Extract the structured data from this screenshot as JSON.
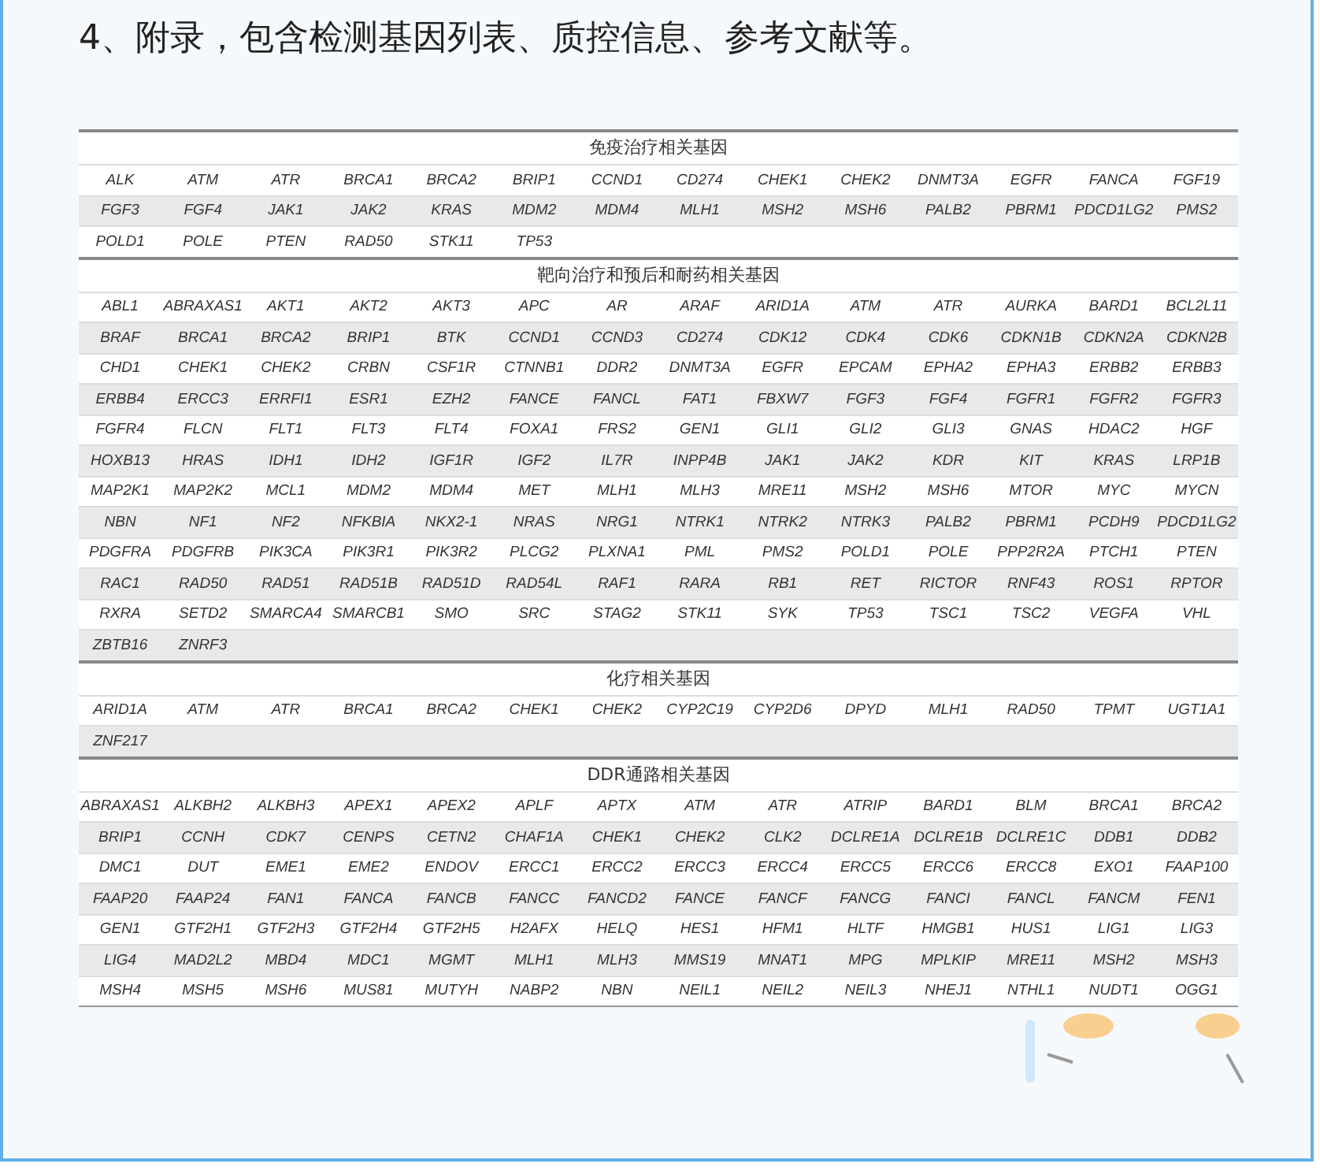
{
  "heading": "4、附录，包含检测基因列表、质控信息、参考文献等。",
  "sections": [
    {
      "title": "免疫治疗相关基因",
      "genes": [
        "ALK",
        "ATM",
        "ATR",
        "BRCA1",
        "BRCA2",
        "BRIP1",
        "CCND1",
        "CD274",
        "CHEK1",
        "CHEK2",
        "DNMT3A",
        "EGFR",
        "FANCA",
        "FGF19",
        "FGF3",
        "FGF4",
        "JAK1",
        "JAK2",
        "KRAS",
        "MDM2",
        "MDM4",
        "MLH1",
        "MSH2",
        "MSH6",
        "PALB2",
        "PBRM1",
        "PDCD1LG2",
        "PMS2",
        "POLD1",
        "POLE",
        "PTEN",
        "RAD50",
        "STK11",
        "TP53"
      ]
    },
    {
      "title": "靶向治疗和预后和耐药相关基因",
      "genes": [
        "ABL1",
        "ABRAXAS1",
        "AKT1",
        "AKT2",
        "AKT3",
        "APC",
        "AR",
        "ARAF",
        "ARID1A",
        "ATM",
        "ATR",
        "AURKA",
        "BARD1",
        "BCL2L11",
        "BRAF",
        "BRCA1",
        "BRCA2",
        "BRIP1",
        "BTK",
        "CCND1",
        "CCND3",
        "CD274",
        "CDK12",
        "CDK4",
        "CDK6",
        "CDKN1B",
        "CDKN2A",
        "CDKN2B",
        "CHD1",
        "CHEK1",
        "CHEK2",
        "CRBN",
        "CSF1R",
        "CTNNB1",
        "DDR2",
        "DNMT3A",
        "EGFR",
        "EPCAM",
        "EPHA2",
        "EPHA3",
        "ERBB2",
        "ERBB3",
        "ERBB4",
        "ERCC3",
        "ERRFI1",
        "ESR1",
        "EZH2",
        "FANCE",
        "FANCL",
        "FAT1",
        "FBXW7",
        "FGF3",
        "FGF4",
        "FGFR1",
        "FGFR2",
        "FGFR3",
        "FGFR4",
        "FLCN",
        "FLT1",
        "FLT3",
        "FLT4",
        "FOXA1",
        "FRS2",
        "GEN1",
        "GLI1",
        "GLI2",
        "GLI3",
        "GNAS",
        "HDAC2",
        "HGF",
        "HOXB13",
        "HRAS",
        "IDH1",
        "IDH2",
        "IGF1R",
        "IGF2",
        "IL7R",
        "INPP4B",
        "JAK1",
        "JAK2",
        "KDR",
        "KIT",
        "KRAS",
        "LRP1B",
        "MAP2K1",
        "MAP2K2",
        "MCL1",
        "MDM2",
        "MDM4",
        "MET",
        "MLH1",
        "MLH3",
        "MRE11",
        "MSH2",
        "MSH6",
        "MTOR",
        "MYC",
        "MYCN",
        "NBN",
        "NF1",
        "NF2",
        "NFKBIA",
        "NKX2-1",
        "NRAS",
        "NRG1",
        "NTRK1",
        "NTRK2",
        "NTRK3",
        "PALB2",
        "PBRM1",
        "PCDH9",
        "PDCD1LG2",
        "PDGFRA",
        "PDGFRB",
        "PIK3CA",
        "PIK3R1",
        "PIK3R2",
        "PLCG2",
        "PLXNA1",
        "PML",
        "PMS2",
        "POLD1",
        "POLE",
        "PPP2R2A",
        "PTCH1",
        "PTEN",
        "RAC1",
        "RAD50",
        "RAD51",
        "RAD51B",
        "RAD51D",
        "RAD54L",
        "RAF1",
        "RARA",
        "RB1",
        "RET",
        "RICTOR",
        "RNF43",
        "ROS1",
        "RPTOR",
        "RXRA",
        "SETD2",
        "SMARCA4",
        "SMARCB1",
        "SMO",
        "SRC",
        "STAG2",
        "STK11",
        "SYK",
        "TP53",
        "TSC1",
        "TSC2",
        "VEGFA",
        "VHL",
        "ZBTB16",
        "ZNRF3"
      ]
    },
    {
      "title": "化疗相关基因",
      "genes": [
        "ARID1A",
        "ATM",
        "ATR",
        "BRCA1",
        "BRCA2",
        "CHEK1",
        "CHEK2",
        "CYP2C19",
        "CYP2D6",
        "DPYD",
        "MLH1",
        "RAD50",
        "TPMT",
        "UGT1A1",
        "ZNF217"
      ]
    },
    {
      "title": "DDR通路相关基因",
      "genes": [
        "ABRAXAS1",
        "ALKBH2",
        "ALKBH3",
        "APEX1",
        "APEX2",
        "APLF",
        "APTX",
        "ATM",
        "ATR",
        "ATRIP",
        "BARD1",
        "BLM",
        "BRCA1",
        "BRCA2",
        "BRIP1",
        "CCNH",
        "CDK7",
        "CENPS",
        "CETN2",
        "CHAF1A",
        "CHEK1",
        "CHEK2",
        "CLK2",
        "DCLRE1A",
        "DCLRE1B",
        "DCLRE1C",
        "DDB1",
        "DDB2",
        "DMC1",
        "DUT",
        "EME1",
        "EME2",
        "ENDOV",
        "ERCC1",
        "ERCC2",
        "ERCC3",
        "ERCC4",
        "ERCC5",
        "ERCC6",
        "ERCC8",
        "EXO1",
        "FAAP100",
        "FAAP20",
        "FAAP24",
        "FAN1",
        "FANCA",
        "FANCB",
        "FANCC",
        "FANCD2",
        "FANCE",
        "FANCF",
        "FANCG",
        "FANCI",
        "FANCL",
        "FANCM",
        "FEN1",
        "GEN1",
        "GTF2H1",
        "GTF2H3",
        "GTF2H4",
        "GTF2H5",
        "H2AFX",
        "HELQ",
        "HES1",
        "HFM1",
        "HLTF",
        "HMGB1",
        "HUS1",
        "LIG1",
        "LIG3",
        "LIG4",
        "MAD2L2",
        "MBD4",
        "MDC1",
        "MGMT",
        "MLH1",
        "MLH3",
        "MMS19",
        "MNAT1",
        "MPG",
        "MPLKIP",
        "MRE11",
        "MSH2",
        "MSH3",
        "MSH4",
        "MSH5",
        "MSH6",
        "MUS81",
        "MUTYH",
        "NABP2",
        "NBN",
        "NEIL1",
        "NEIL2",
        "NEIL3",
        "NHEJ1",
        "NTHL1",
        "NUDT1",
        "OGG1"
      ]
    }
  ]
}
